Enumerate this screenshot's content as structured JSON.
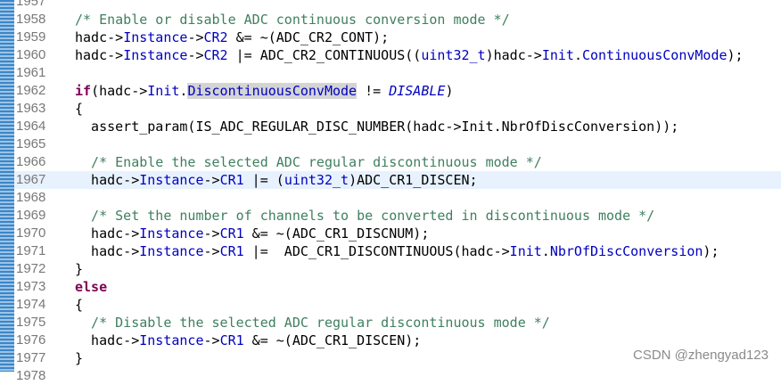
{
  "editor": {
    "lines": [
      {
        "num": "1957",
        "code": []
      },
      {
        "num": "1958",
        "code": [
          {
            "t": "/* Enable or disable ADC continuous conversion mode */",
            "c": "cm"
          }
        ]
      },
      {
        "num": "1959",
        "code": [
          {
            "t": "hadc->",
            "c": ""
          },
          {
            "t": "Instance",
            "c": "fld"
          },
          {
            "t": "->",
            "c": ""
          },
          {
            "t": "CR2",
            "c": "fld"
          },
          {
            "t": " &= ~(ADC_CR2_CONT);",
            "c": ""
          }
        ]
      },
      {
        "num": "1960",
        "code": [
          {
            "t": "hadc->",
            "c": ""
          },
          {
            "t": "Instance",
            "c": "fld"
          },
          {
            "t": "->",
            "c": ""
          },
          {
            "t": "CR2",
            "c": "fld"
          },
          {
            "t": " |= ADC_CR2_CONTINUOUS((",
            "c": ""
          },
          {
            "t": "uint32_t",
            "c": "fld"
          },
          {
            "t": ")hadc->",
            "c": ""
          },
          {
            "t": "Init",
            "c": "fld"
          },
          {
            "t": ".",
            "c": ""
          },
          {
            "t": "ContinuousConvMode",
            "c": "fld"
          },
          {
            "t": ");",
            "c": ""
          }
        ]
      },
      {
        "num": "1961",
        "code": []
      },
      {
        "num": "1962",
        "code": [
          {
            "t": "if",
            "c": "kw"
          },
          {
            "t": "(hadc->",
            "c": ""
          },
          {
            "t": "Init",
            "c": "fld"
          },
          {
            "t": ".",
            "c": ""
          },
          {
            "t": "DiscontinuousConvMode",
            "c": "fld hl"
          },
          {
            "t": " != ",
            "c": ""
          },
          {
            "t": "DISABLE",
            "c": "ital"
          },
          {
            "t": ")",
            "c": ""
          }
        ]
      },
      {
        "num": "1963",
        "code": [
          {
            "t": "{",
            "c": ""
          }
        ]
      },
      {
        "num": "1964",
        "code": [
          {
            "t": "  assert_param(IS_ADC_REGULAR_DISC_NUMBER(hadc->Init.NbrOfDiscConversion));",
            "c": ""
          }
        ]
      },
      {
        "num": "1965",
        "code": []
      },
      {
        "num": "1966",
        "code": [
          {
            "t": "  /* Enable the selected ADC regular discontinuous mode */",
            "c": "cm"
          }
        ]
      },
      {
        "num": "1967",
        "current": true,
        "code": [
          {
            "t": "  hadc->",
            "c": ""
          },
          {
            "t": "Instance",
            "c": "fld"
          },
          {
            "t": "->",
            "c": ""
          },
          {
            "t": "CR1",
            "c": "fld"
          },
          {
            "t": " |= (",
            "c": ""
          },
          {
            "t": "uint32_t",
            "c": "fld"
          },
          {
            "t": ")ADC_CR1_DISCEN;",
            "c": ""
          }
        ]
      },
      {
        "num": "1968",
        "code": []
      },
      {
        "num": "1969",
        "code": [
          {
            "t": "  /* Set the number of channels to be converted in discontinuous mode */",
            "c": "cm"
          }
        ]
      },
      {
        "num": "1970",
        "code": [
          {
            "t": "  hadc->",
            "c": ""
          },
          {
            "t": "Instance",
            "c": "fld"
          },
          {
            "t": "->",
            "c": ""
          },
          {
            "t": "CR1",
            "c": "fld"
          },
          {
            "t": " &= ~(ADC_CR1_DISCNUM);",
            "c": ""
          }
        ]
      },
      {
        "num": "1971",
        "code": [
          {
            "t": "  hadc->",
            "c": ""
          },
          {
            "t": "Instance",
            "c": "fld"
          },
          {
            "t": "->",
            "c": ""
          },
          {
            "t": "CR1",
            "c": "fld"
          },
          {
            "t": " |=  ADC_CR1_DISCONTINUOUS(hadc->",
            "c": ""
          },
          {
            "t": "Init",
            "c": "fld"
          },
          {
            "t": ".",
            "c": ""
          },
          {
            "t": "NbrOfDiscConversion",
            "c": "fld"
          },
          {
            "t": ");",
            "c": ""
          }
        ]
      },
      {
        "num": "1972",
        "code": [
          {
            "t": "}",
            "c": ""
          }
        ]
      },
      {
        "num": "1973",
        "code": [
          {
            "t": "else",
            "c": "kw"
          }
        ]
      },
      {
        "num": "1974",
        "code": [
          {
            "t": "{",
            "c": ""
          }
        ]
      },
      {
        "num": "1975",
        "code": [
          {
            "t": "  /* Disable the selected ADC regular discontinuous mode */",
            "c": "cm"
          }
        ]
      },
      {
        "num": "1976",
        "code": [
          {
            "t": "  hadc->",
            "c": ""
          },
          {
            "t": "Instance",
            "c": "fld"
          },
          {
            "t": "->",
            "c": ""
          },
          {
            "t": "CR1",
            "c": "fld"
          },
          {
            "t": " &= ~(ADC_CR1_DISCEN);",
            "c": ""
          }
        ]
      },
      {
        "num": "1977",
        "code": [
          {
            "t": "}",
            "c": ""
          }
        ]
      },
      {
        "num": "1978",
        "code": []
      }
    ]
  },
  "watermark": "CSDN @zhengyad123",
  "colors": {
    "comment": "#3f7f5f",
    "keyword": "#7f0055",
    "field": "#0000c0",
    "current_line": "#e8f2fe",
    "gutter": "#3a86c8"
  }
}
